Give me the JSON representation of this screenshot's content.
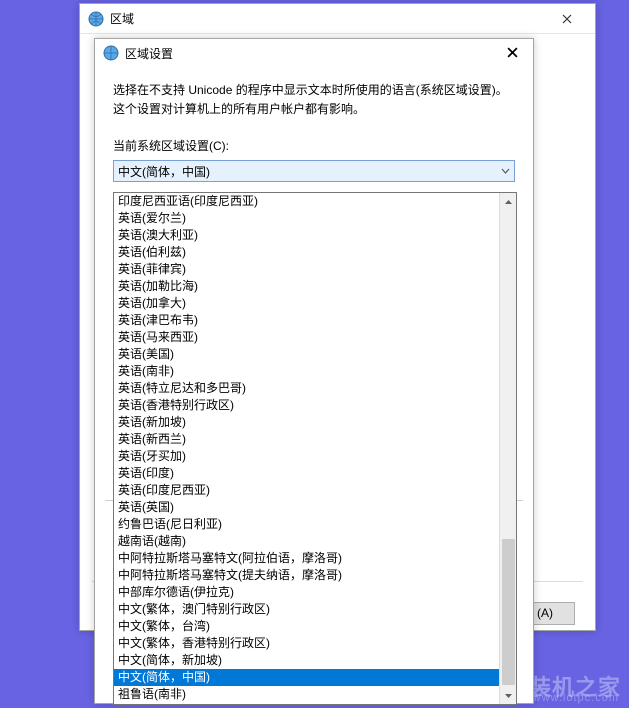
{
  "outer": {
    "title": "区域",
    "apply_button": "(A)"
  },
  "inner": {
    "title": "区域设置",
    "description": "选择在不支持 Unicode 的程序中显示文本时所使用的语言(系统区域设置)。这个设置对计算机上的所有用户帐户都有影响。",
    "label": "当前系统区域设置(C):",
    "selected": "中文(简体，中国)"
  },
  "dropdown": {
    "items": [
      "印度尼西亚语(印度尼西亚)",
      "英语(爱尔兰)",
      "英语(澳大利亚)",
      "英语(伯利兹)",
      "英语(菲律宾)",
      "英语(加勒比海)",
      "英语(加拿大)",
      "英语(津巴布韦)",
      "英语(马来西亚)",
      "英语(美国)",
      "英语(南非)",
      "英语(特立尼达和多巴哥)",
      "英语(香港特别行政区)",
      "英语(新加坡)",
      "英语(新西兰)",
      "英语(牙买加)",
      "英语(印度)",
      "英语(印度尼西亚)",
      "英语(英国)",
      "约鲁巴语(尼日利亚)",
      "越南语(越南)",
      "中阿特拉斯塔马塞特文(阿拉伯语，摩洛哥)",
      "中阿特拉斯塔马塞特文(提夫纳语，摩洛哥)",
      "中部库尔德语(伊拉克)",
      "中文(繁体，澳门特别行政区)",
      "中文(繁体，台湾)",
      "中文(繁体，香港特别行政区)",
      "中文(简体，新加坡)",
      "中文(简体，中国)",
      "祖鲁语(南非)"
    ],
    "selected_index": 28
  },
  "watermark": {
    "text": "装机之家",
    "url": "www.lotpc.com"
  }
}
